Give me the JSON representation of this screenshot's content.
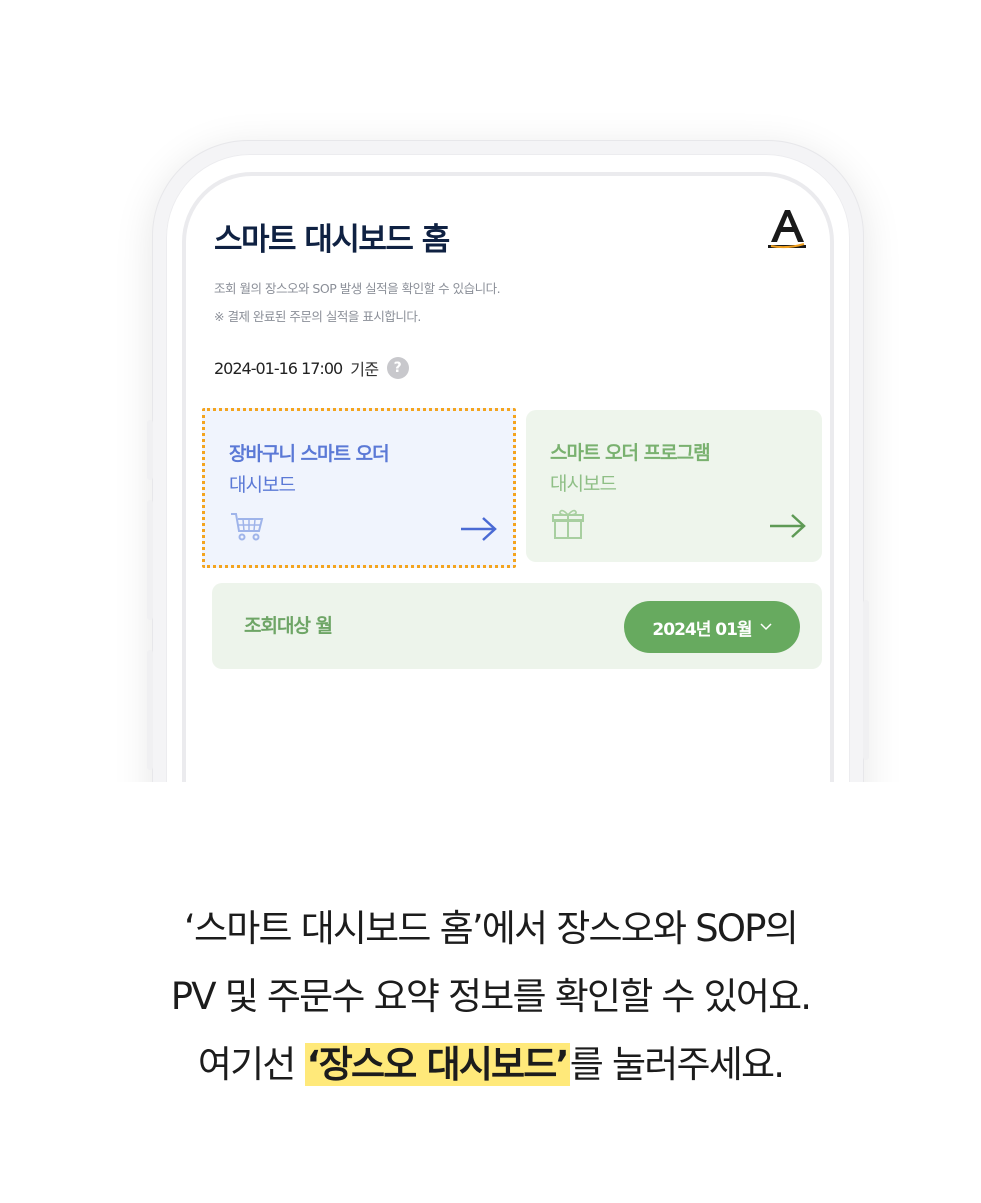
{
  "app": {
    "title": "스마트 대시보드 홈",
    "logo_icon": "a-brand-logo-icon",
    "description_lines": [
      "조회 월의 장스오와 SOP 발생 실적을 확인할 수 있습니다.",
      "※ 결제 완료된 주문의 실적을 표시합니다."
    ],
    "timestamp": "2024-01-16 17:00",
    "timestamp_suffix": "기준",
    "help_icon_glyph": "?"
  },
  "cards": [
    {
      "line1": "장바구니 스마트 오더",
      "line2": "대시보드",
      "icon": "shopping-cart-icon",
      "arrow_icon": "arrow-right-icon",
      "accent": "#5b79d6",
      "highlighted": true
    },
    {
      "line1": "스마트 오더 프로그램",
      "line2": "대시보드",
      "icon": "gift-icon",
      "arrow_icon": "arrow-right-icon",
      "accent": "#79b16f",
      "highlighted": false
    }
  ],
  "month_filter": {
    "label": "조회대상 월",
    "selected": "2024년 01월",
    "chevron_icon": "chevron-down-icon"
  },
  "caption": {
    "line1": "‘스마트 대시보드 홈’에서 장스오와 SOP의",
    "line2": "PV 및 주문수 요약 정보를 확인할 수 있어요.",
    "line3_prefix": "여기선 ",
    "line3_highlight": "‘장스오 대시보드’",
    "line3_suffix": "를 눌러주세요."
  },
  "colors": {
    "highlight_border": "#f4a41e",
    "caption_highlight": "#ffe97a",
    "green_accent": "#67aa5f",
    "title_navy": "#0f2142"
  }
}
